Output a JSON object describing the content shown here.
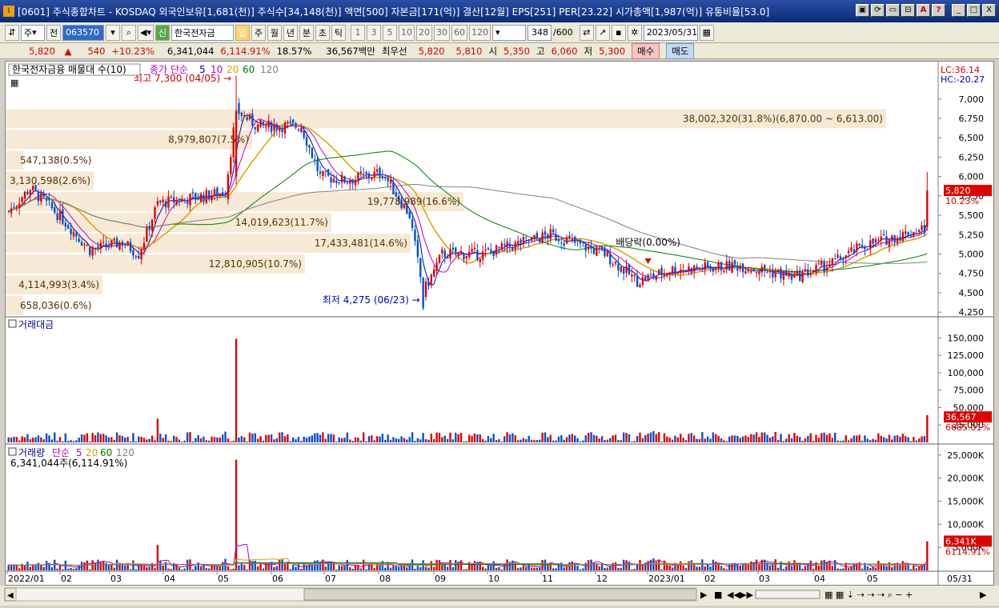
{
  "window": {
    "app_icon": "I",
    "title": "[0601] 주식종합차트 - KOSDAQ 외국인보유[1,681(천)] 주식수[34,148(천)] 액면[500] 자본금[171(억)] 결산[12월] EPS[251] PER[23.22] 시가총액[1,987(억)] 유통비율[53.0]",
    "buttons": [
      "▣",
      "⟳",
      "▭",
      "⊟",
      "A",
      "?",
      "_",
      "□",
      "X"
    ]
  },
  "toolbar": {
    "market_select": "주",
    "all_label": "전",
    "code": "063570",
    "stock_tag": "신",
    "stock_name": "한국전자금",
    "period_tabs": [
      "일",
      "주",
      "월",
      "년",
      "분",
      "초",
      "틱"
    ],
    "interval_tabs": [
      "1",
      "3",
      "5",
      "10",
      "20",
      "30",
      "60",
      "120"
    ],
    "count": "348",
    "count_total": "/600",
    "date": "2023/05/31"
  },
  "quote": {
    "price": "5,820",
    "change": "540",
    "change_pct": "+10.23%",
    "volume": "6,341,044",
    "volume_ratio": "6,114.91%",
    "turnover": "18.57%",
    "amount": "36,567백만",
    "best_ask_label": "최우선",
    "best_ask": "5,820",
    "best_bid": "5,810",
    "open_label": "시",
    "open": "5,350",
    "high_label": "고",
    "high": "6,060",
    "low_label": "저",
    "low": "5,300",
    "buy_label": "매수",
    "sell_label": "매도"
  },
  "chart_data": [
    {
      "type": "candlestick",
      "title": "한국전자금융 매물대 수(10)",
      "ma_label": "종가 단순",
      "ma_periods": [
        "5",
        "10",
        "20",
        "60",
        "120"
      ],
      "ma_colors": [
        "#0000c0",
        "#c000c0",
        "#e0a000",
        "#008000",
        "#808080"
      ],
      "lc_label": "LC:36.14",
      "hc_label": "HC:-20.27",
      "ylim": [
        4200,
        7400
      ],
      "y_ticks": [
        "7,000",
        "6,750",
        "6,500",
        "6,250",
        "6,000",
        "5,750",
        "5,500",
        "5,250",
        "5,000",
        "4,750",
        "4,500",
        "4,250"
      ],
      "price_tag": "5,820",
      "price_tag_pct": "10.23%",
      "high_annotation": "최고 7,300 (04/05)",
      "low_annotation": "최저 4,275 (06/23)",
      "dividend_annotation": "배당락(0.00%)",
      "volume_profile": [
        {
          "label": "38,002,320(31.8%)(6,870.00 ~ 6,613.00)",
          "frac": 1.0
        },
        {
          "label": "8,979,807(7.5%)",
          "frac": 0.28
        },
        {
          "label": "547,138(0.5%)",
          "frac": 0.02
        },
        {
          "label": "3,130,598(2.6%)",
          "frac": 0.1
        },
        {
          "label": "19,778,989(16.6%)",
          "frac": 0.52
        },
        {
          "label": "14,019,623(11.7%)",
          "frac": 0.37
        },
        {
          "label": "17,433,481(14.6%)",
          "frac": 0.46
        },
        {
          "label": "12,810,905(10.7%)",
          "frac": 0.34
        },
        {
          "label": "4,114,993(3.4%)",
          "frac": 0.11
        },
        {
          "label": "658,036(0.6%)",
          "frac": 0.02
        }
      ]
    },
    {
      "type": "bar",
      "title": "거래대금",
      "y_ticks": [
        "150,000",
        "125,000",
        "100,000",
        "75,000",
        "50,000",
        "25,000"
      ],
      "ylim": [
        0,
        170000
      ],
      "last_tag": "36,567",
      "last_tag_pct": "6685.01%"
    },
    {
      "type": "bar",
      "title": "거래량",
      "ma_label": "단순",
      "ma_periods": [
        "5",
        "20",
        "60",
        "120"
      ],
      "sub_label": "6,341,044주(6,114.91%)",
      "y_ticks": [
        "25,000K",
        "20,000K",
        "15,000K",
        "10,000K",
        "5,000K"
      ],
      "ylim": [
        0,
        26000
      ],
      "last_tag": "6,341K",
      "last_tag_pct": "6114.91%"
    }
  ],
  "x_axis": [
    "2022/01",
    "02",
    "03",
    "04",
    "05",
    "06",
    "07",
    "08",
    "09",
    "10",
    "11",
    "12",
    "2023/01",
    "02",
    "03",
    "04",
    "05",
    "05/31"
  ],
  "colors": {
    "up": "#e00000",
    "down": "#0050d0",
    "profile": "#f5e6cf",
    "tag": "#e00000"
  }
}
